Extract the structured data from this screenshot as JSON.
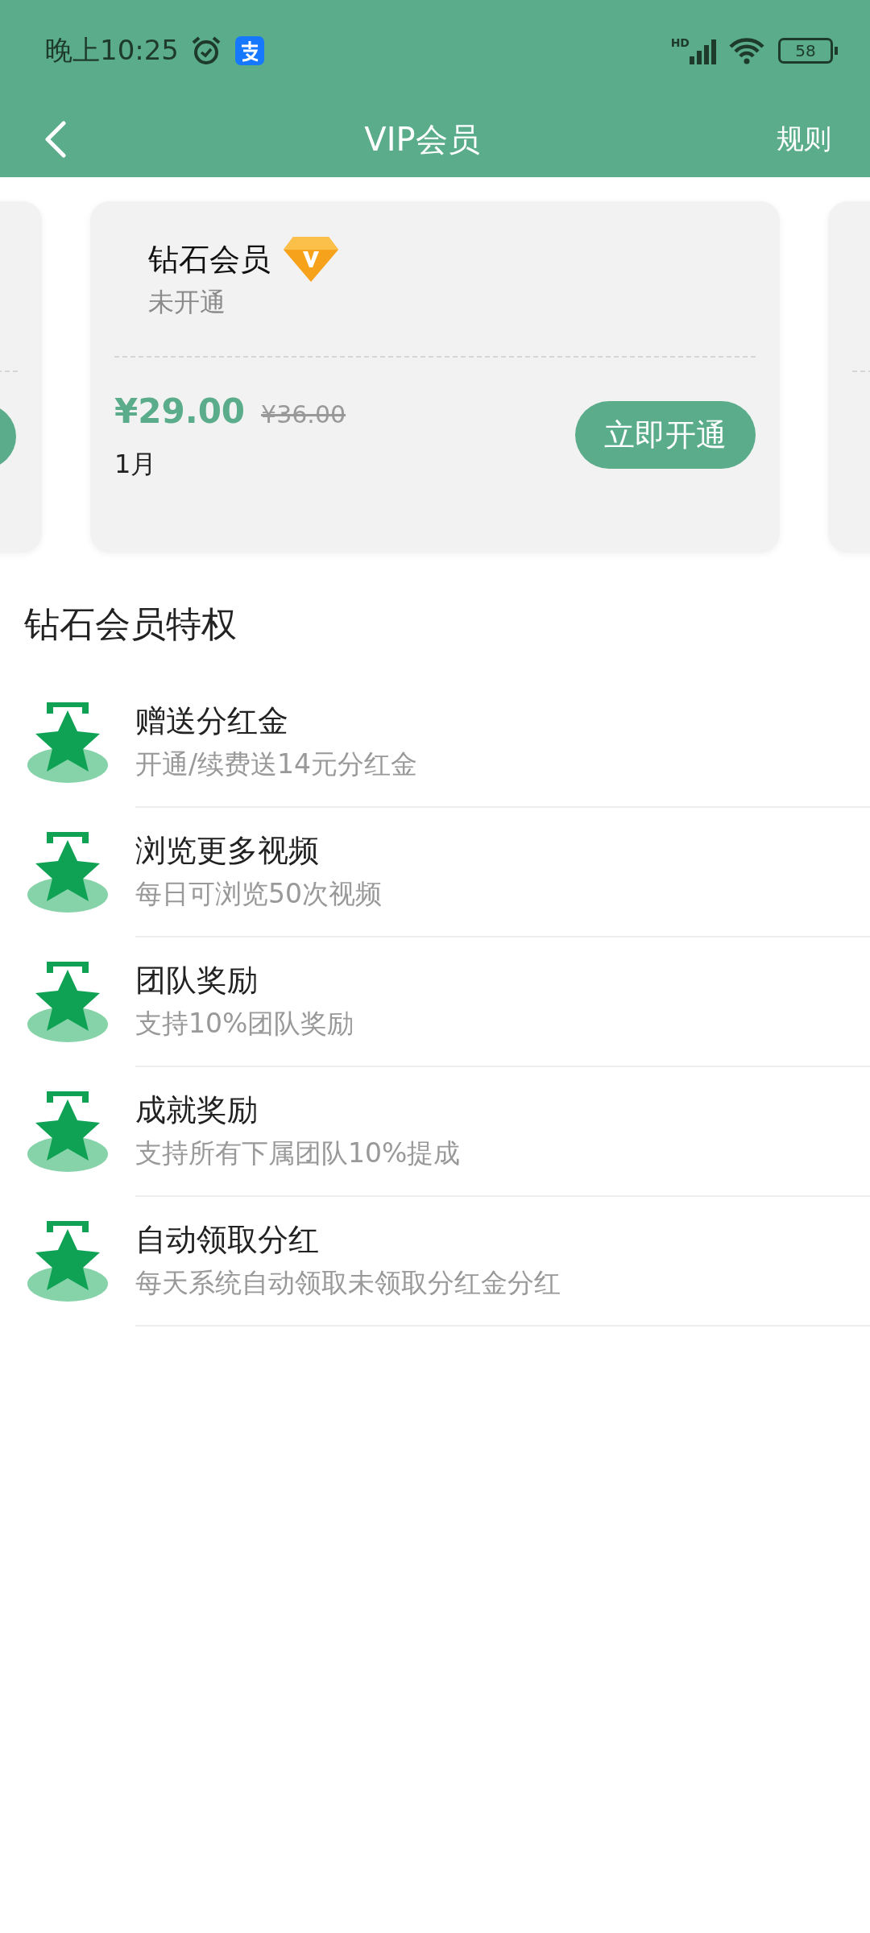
{
  "status_bar": {
    "time": "晚上10:25",
    "network": "HD",
    "battery": "58"
  },
  "header": {
    "title": "VIP会员",
    "action": "规则"
  },
  "plan_card": {
    "name": "钻石会员",
    "status": "未开通",
    "price": "¥29.00",
    "original_price": "¥36.00",
    "period": "1月",
    "button": "立即开通"
  },
  "privileges_title": "钻石会员特权",
  "privileges": [
    {
      "title": "赠送分红金",
      "description": "开通/续费送14元分红金"
    },
    {
      "title": "浏览更多视频",
      "description": "每日可浏览50次视频"
    },
    {
      "title": "团队奖励",
      "description": "支持10%团队奖励"
    },
    {
      "title": "成就奖励",
      "description": "支持所有下属团队10%提成"
    },
    {
      "title": "自动领取分红",
      "description": "每天系统自动领取未领取分红金分红"
    }
  ]
}
